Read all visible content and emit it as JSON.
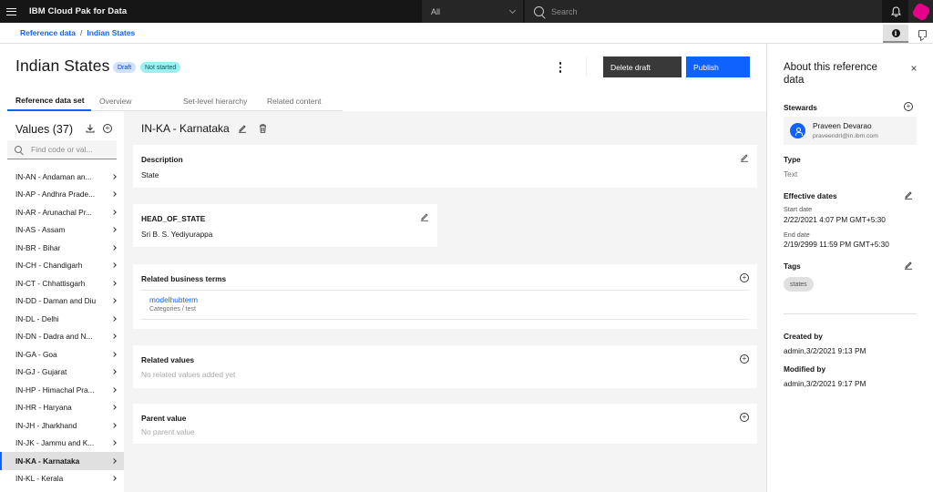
{
  "topbar": {
    "app_title": "IBM Cloud Pak for Data",
    "scope_value": "All",
    "search_placeholder": "Search",
    "icons": [
      "hamburger-menu-icon",
      "chevron-down-icon",
      "search-icon",
      "notification-bell-icon",
      "user-avatar-icon"
    ]
  },
  "breadcrumb": {
    "items": [
      "Reference data",
      "Indian States"
    ],
    "separator": "/"
  },
  "side_toggles": {
    "info_icon": "info-icon",
    "comment_icon": "comment-icon"
  },
  "header": {
    "title": "Indian States",
    "tags": [
      {
        "label": "Draft",
        "color": "#d0e2ff"
      },
      {
        "label": "Not started",
        "color": "#9ef0f0"
      }
    ],
    "buttons": {
      "delete_draft": "Delete draft",
      "publish": "Publish"
    },
    "accent_color": "#0f62fe"
  },
  "tabs": [
    {
      "label": "Reference data set",
      "active": true
    },
    {
      "label": "Overview",
      "active": false
    },
    {
      "label": "Set-level hierarchy",
      "active": false
    },
    {
      "label": "Related content",
      "active": false
    }
  ],
  "values_panel": {
    "title": "Values (37)",
    "filter_placeholder": "Find code or val...",
    "items": [
      {
        "label": "IN-AN - Andaman an...",
        "selected": false
      },
      {
        "label": "IN-AP - Andhra Prade...",
        "selected": false
      },
      {
        "label": "IN-AR - Arunachal Pr...",
        "selected": false
      },
      {
        "label": "IN-AS - Assam",
        "selected": false
      },
      {
        "label": "IN-BR - Bihar",
        "selected": false
      },
      {
        "label": "IN-CH - Chandigarh",
        "selected": false
      },
      {
        "label": "IN-CT - Chhattisgarh",
        "selected": false
      },
      {
        "label": "IN-DD - Daman and Diu",
        "selected": false
      },
      {
        "label": "IN-DL - Delhi",
        "selected": false
      },
      {
        "label": "IN-DN - Dadra and N...",
        "selected": false
      },
      {
        "label": "IN-GA - Goa",
        "selected": false
      },
      {
        "label": "IN-GJ - Gujarat",
        "selected": false
      },
      {
        "label": "IN-HP - Himachal Pra...",
        "selected": false
      },
      {
        "label": "IN-HR - Haryana",
        "selected": false
      },
      {
        "label": "IN-JH - Jharkhand",
        "selected": false
      },
      {
        "label": "IN-JK - Jammu and K...",
        "selected": false
      },
      {
        "label": "IN-KA - Karnataka",
        "selected": true
      },
      {
        "label": "IN-KL - Kerala",
        "selected": false
      }
    ]
  },
  "detail": {
    "title": "IN-KA - Karnataka",
    "description": {
      "label": "Description",
      "value": "State"
    },
    "custom_attr": {
      "label": "HEAD_OF_STATE",
      "value": "Sri B. S. Yediyurappa"
    },
    "related_terms": {
      "label": "Related business terms",
      "items": [
        {
          "name": "modelhubterm",
          "path": "Categories  / test"
        }
      ]
    },
    "related_values": {
      "label": "Related values",
      "empty": "No related values added yet"
    },
    "parent_value": {
      "label": "Parent value",
      "empty": "No parent value"
    }
  },
  "about_panel": {
    "title": "About this reference data",
    "stewards_label": "Stewards",
    "steward": {
      "name": "Praveen Devarao",
      "email": "praveendrl@in.ibm.com"
    },
    "type_label": "Type",
    "type_value": "Text",
    "effective_dates_label": "Effective dates",
    "start_date_label": "Start date",
    "start_date": "2/22/2021 4:07 PM GMT+5:30",
    "end_date_label": "End date",
    "end_date": "2/19/2999 11:59 PM GMT+5:30",
    "tags_label": "Tags",
    "tags": [
      "states"
    ],
    "created_by_label": "Created by",
    "created_by": "admin,3/2/2021 9:13 PM",
    "modified_by_label": "Modified by",
    "modified_by": "admin,3/2/2021 9:17 PM"
  }
}
